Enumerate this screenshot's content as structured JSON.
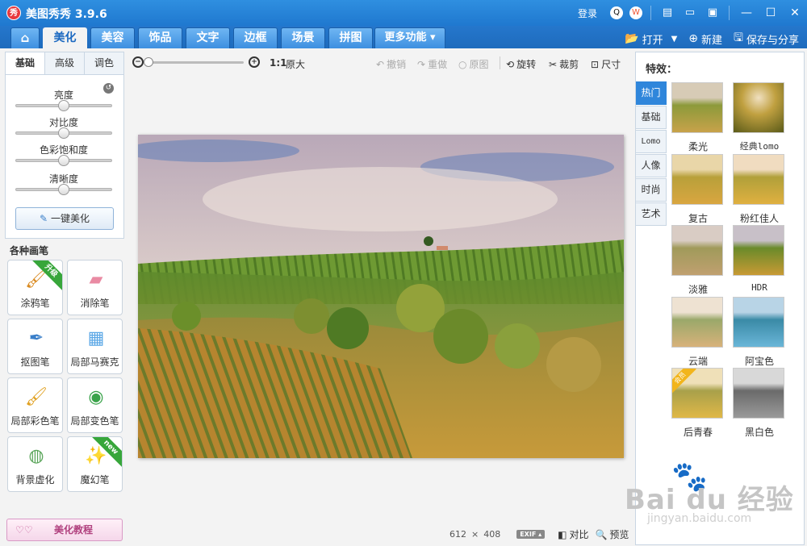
{
  "app": {
    "title": "美图秀秀 3.9.6",
    "logo_text": "秀"
  },
  "titlebar": {
    "login": "登录"
  },
  "tabs": [
    {
      "label": "美化",
      "active": true
    },
    {
      "label": "美容"
    },
    {
      "label": "饰品"
    },
    {
      "label": "文字"
    },
    {
      "label": "边框"
    },
    {
      "label": "场景"
    },
    {
      "label": "拼图"
    },
    {
      "label": "更多功能 ▾"
    }
  ],
  "actions": {
    "open": "打开",
    "new": "新建",
    "save_share": "保存与分享"
  },
  "adjust": {
    "subtabs": [
      "基础",
      "高级",
      "调色"
    ],
    "sliders": [
      {
        "label": "亮度",
        "value": 0.5
      },
      {
        "label": "对比度",
        "value": 0.5
      },
      {
        "label": "色彩饱和度",
        "value": 0.5
      },
      {
        "label": "清晰度",
        "value": 0.5
      }
    ],
    "one_click": "一键美化"
  },
  "brushes": {
    "title": "各种画笔",
    "items": [
      {
        "label": "涂鸦笔",
        "badge": "升级"
      },
      {
        "label": "消除笔"
      },
      {
        "label": "抠图笔"
      },
      {
        "label": "局部马赛克"
      },
      {
        "label": "局部彩色笔"
      },
      {
        "label": "局部变色笔"
      },
      {
        "label": "背景虚化"
      },
      {
        "label": "魔幻笔",
        "badge": "new"
      }
    ]
  },
  "tutorial": "美化教程",
  "canvas_toolbar": {
    "ratio": "1:1",
    "original_size": "原大",
    "undo": "撤销",
    "redo": "重做",
    "original": "原图",
    "rotate": "旋转",
    "crop": "裁剪",
    "size": "尺寸"
  },
  "image_info": {
    "width": "612",
    "times": "×",
    "height": "408",
    "exif": "EXIF ▴",
    "compare": "对比",
    "preview": "预览"
  },
  "effects": {
    "title": "特效：",
    "categories": [
      "热门",
      "基础",
      "Lomo",
      "人像",
      "时尚",
      "艺术"
    ],
    "items": [
      {
        "label": "柔光"
      },
      {
        "label": "经典lomo"
      },
      {
        "label": "复古"
      },
      {
        "label": "粉红佳人"
      },
      {
        "label": "淡雅"
      },
      {
        "label": "HDR"
      },
      {
        "label": "云端"
      },
      {
        "label": "阿宝色"
      },
      {
        "label": "后青春",
        "badge": "会员"
      },
      {
        "label": "黑白色"
      }
    ]
  },
  "watermark": {
    "main": "Bai du 经验",
    "sub": "jingyan.baidu.com"
  }
}
